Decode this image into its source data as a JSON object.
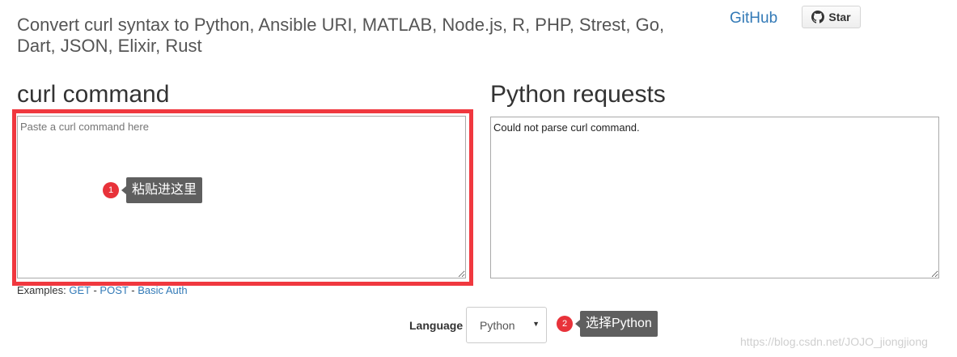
{
  "header": {
    "subtitle": "Convert curl syntax to Python, Ansible URI, MATLAB, Node.js, R, PHP, Strest, Go, Dart, JSON, Elixir, Rust",
    "github_link": "GitHub",
    "star_button": "Star",
    "star_icon": "github-octocat-icon"
  },
  "left_panel": {
    "heading": "curl command",
    "textarea_value": "",
    "textarea_placeholder": "Paste a curl command here",
    "examples_label": "Examples:",
    "examples": [
      "GET",
      "POST",
      "Basic Auth"
    ],
    "separator": "-"
  },
  "right_panel": {
    "heading": "Python requests",
    "output_text": "Could not parse curl command."
  },
  "language": {
    "label": "Language",
    "selected": "Python"
  },
  "annotations": [
    {
      "number": "1",
      "text": "粘贴进这里"
    },
    {
      "number": "2",
      "text": "选择Python"
    }
  ],
  "watermark": "https://blog.csdn.net/JOJO_jiongjiong",
  "colors": {
    "highlight_frame": "#f0383f",
    "badge": "#e8323a",
    "tooltip_bg": "#5f5f5f",
    "link": "#337ab7"
  }
}
